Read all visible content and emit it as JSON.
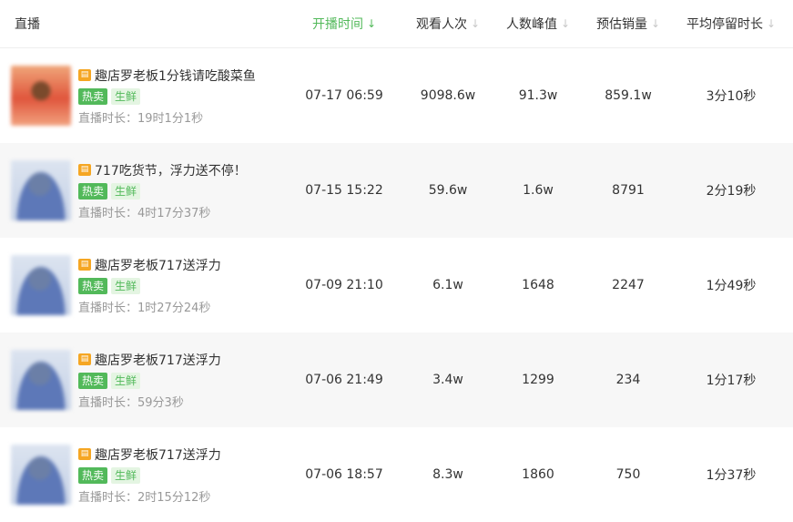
{
  "header": {
    "live": "直播",
    "start_time": "开播时间",
    "views": "观看人次",
    "peak": "人数峰值",
    "sales": "预估销量",
    "avg_stay": "平均停留时长",
    "sort_icon": "↓"
  },
  "rows": [
    {
      "title": "趣店罗老板1分钱请吃酸菜鱼",
      "tag_hot": "热卖",
      "tag_fresh": "生鲜",
      "duration": "直播时长：19时1分1秒",
      "start_time": "07-17 06:59",
      "views": "9098.6w",
      "peak": "91.3w",
      "sales": "859.1w",
      "avg_stay": "3分10秒"
    },
    {
      "title": "717吃货节，浮力送不停！",
      "tag_hot": "热卖",
      "tag_fresh": "生鲜",
      "duration": "直播时长：4时17分37秒",
      "start_time": "07-15 15:22",
      "views": "59.6w",
      "peak": "1.6w",
      "sales": "8791",
      "avg_stay": "2分19秒"
    },
    {
      "title": "趣店罗老板717送浮力",
      "tag_hot": "热卖",
      "tag_fresh": "生鲜",
      "duration": "直播时长：1时27分24秒",
      "start_time": "07-09 21:10",
      "views": "6.1w",
      "peak": "1648",
      "sales": "2247",
      "avg_stay": "1分49秒"
    },
    {
      "title": "趣店罗老板717送浮力",
      "tag_hot": "热卖",
      "tag_fresh": "生鲜",
      "duration": "直播时长：59分3秒",
      "start_time": "07-06 21:49",
      "views": "3.4w",
      "peak": "1299",
      "sales": "234",
      "avg_stay": "1分17秒"
    },
    {
      "title": "趣店罗老板717送浮力",
      "tag_hot": "热卖",
      "tag_fresh": "生鲜",
      "duration": "直播时长：2时15分12秒",
      "start_time": "07-06 18:57",
      "views": "8.3w",
      "peak": "1860",
      "sales": "750",
      "avg_stay": "1分37秒"
    }
  ],
  "colors": {
    "accent": "#52b95a",
    "cart": "#f5a623"
  },
  "icons": {
    "cart": "cart-icon",
    "sort": "sort-arrow-icon"
  }
}
